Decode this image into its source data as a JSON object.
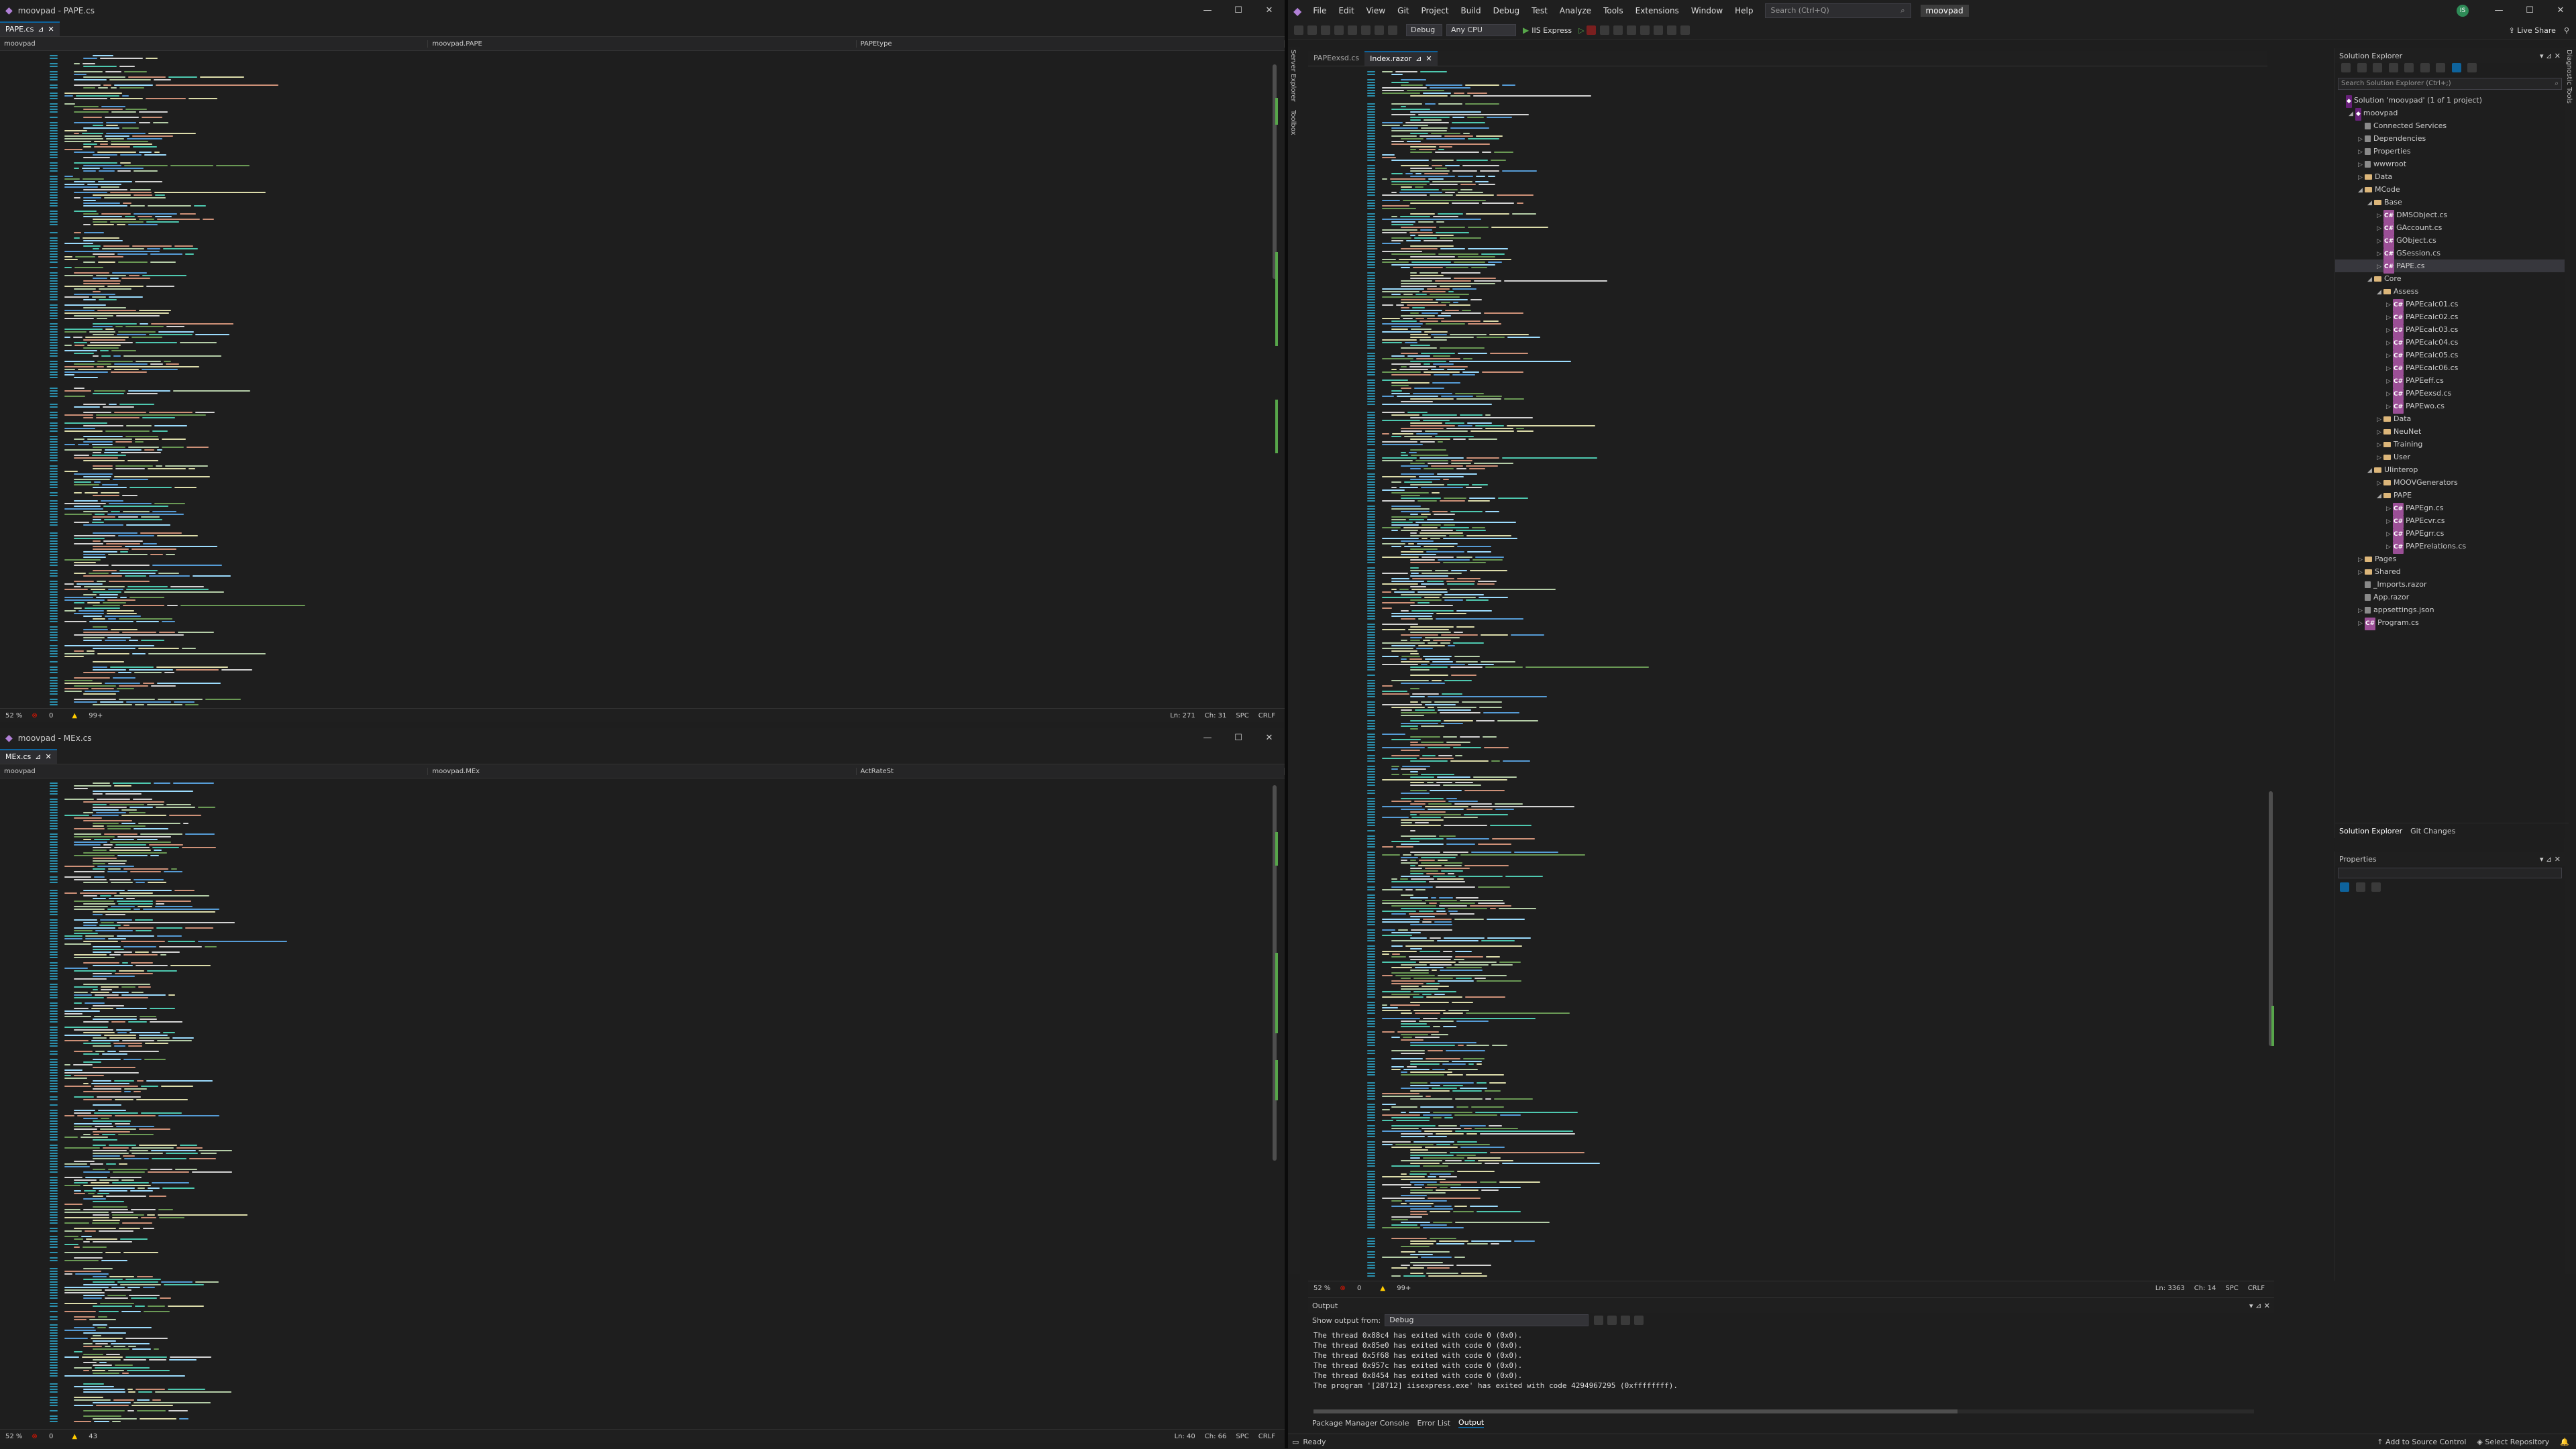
{
  "left_top": {
    "window_title": "moovpad - PAPE.cs",
    "tab": "PAPE.cs",
    "nav": {
      "project": "moovpad",
      "class": "moovpad.PAPE",
      "member": "PAPEtype"
    },
    "status": {
      "zoom": "52 %",
      "errors": "0",
      "warnings": "99+",
      "line": "Ln: 271",
      "col": "Ch: 31",
      "spc": "SPC",
      "crlf": "CRLF"
    }
  },
  "left_bottom": {
    "window_title": "moovpad - MEx.cs",
    "tab": "MEx.cs",
    "nav": {
      "project": "moovpad",
      "class": "moovpad.MEx",
      "member": "ActRateSt"
    },
    "status": {
      "zoom": "52 %",
      "errors": "0",
      "warnings": "43",
      "line": "Ln: 40",
      "col": "Ch: 66",
      "spc": "SPC",
      "crlf": "CRLF"
    }
  },
  "right": {
    "menu": [
      "File",
      "Edit",
      "View",
      "Git",
      "Project",
      "Build",
      "Debug",
      "Test",
      "Analyze",
      "Tools",
      "Extensions",
      "Window",
      "Help"
    ],
    "search_placeholder": "Search (Ctrl+Q)",
    "solution_name": "moovpad",
    "avatar": "IS",
    "toolbar": {
      "config": "Debug",
      "platform": "Any CPU",
      "run_target": "IIS Express",
      "live_share": "Live Share"
    },
    "side_tabs": [
      "Server Explorer",
      "Toolbox"
    ],
    "right_side_tab": "Diagnostic Tools",
    "editor_tabs": [
      {
        "label": "PAPEexsd.cs",
        "active": false
      },
      {
        "label": "Index.razor",
        "active": true
      }
    ],
    "editor_status": {
      "zoom": "52 %",
      "errors": "0",
      "warnings": "99+",
      "line": "Ln: 3363",
      "col": "Ch: 14",
      "spc": "SPC",
      "crlf": "CRLF"
    },
    "output": {
      "title": "Output",
      "show_from_label": "Show output from:",
      "show_from_value": "Debug",
      "lines": [
        "The thread 0x88c4 has exited with code 0 (0x0).",
        "The thread 0x85e0 has exited with code 0 (0x0).",
        "The thread 0x5f68 has exited with code 0 (0x0).",
        "The thread 0x957c has exited with code 0 (0x0).",
        "The thread 0x8454 has exited with code 0 (0x0).",
        "The program '[28712] iisexpress.exe' has exited with code 4294967295 (0xffffffff)."
      ],
      "tabs": [
        "Package Manager Console",
        "Error List",
        "Output"
      ]
    },
    "solution_explorer": {
      "title": "Solution Explorer",
      "search_placeholder": "Search Solution Explorer (Ctrl+;)",
      "items": [
        {
          "label": "Solution 'moovpad' (1 of 1 project)",
          "indent": 0,
          "kind": "solution",
          "arrow": ""
        },
        {
          "label": "moovpad",
          "indent": 1,
          "kind": "project",
          "arrow": "◢"
        },
        {
          "label": "Connected Services",
          "indent": 2,
          "kind": "gen",
          "arrow": ""
        },
        {
          "label": "Dependencies",
          "indent": 2,
          "kind": "gen",
          "arrow": "▷"
        },
        {
          "label": "Properties",
          "indent": 2,
          "kind": "gen",
          "arrow": "▷"
        },
        {
          "label": "wwwroot",
          "indent": 2,
          "kind": "gen",
          "arrow": "▷"
        },
        {
          "label": "Data",
          "indent": 2,
          "kind": "folder",
          "arrow": "▷"
        },
        {
          "label": "MCode",
          "indent": 2,
          "kind": "folder",
          "arrow": "◢"
        },
        {
          "label": "Base",
          "indent": 3,
          "kind": "folder",
          "arrow": "◢"
        },
        {
          "label": "DMSObject.cs",
          "indent": 4,
          "kind": "cs",
          "arrow": "▷"
        },
        {
          "label": "GAccount.cs",
          "indent": 4,
          "kind": "cs",
          "arrow": "▷"
        },
        {
          "label": "GObject.cs",
          "indent": 4,
          "kind": "cs",
          "arrow": "▷"
        },
        {
          "label": "GSession.cs",
          "indent": 4,
          "kind": "cs",
          "arrow": "▷"
        },
        {
          "label": "PAPE.cs",
          "indent": 4,
          "kind": "cs",
          "arrow": "▷",
          "selected": true
        },
        {
          "label": "Core",
          "indent": 3,
          "kind": "folder",
          "arrow": "◢"
        },
        {
          "label": "Assess",
          "indent": 4,
          "kind": "folder",
          "arrow": "◢"
        },
        {
          "label": "PAPEcalc01.cs",
          "indent": 5,
          "kind": "cs",
          "arrow": "▷"
        },
        {
          "label": "PAPEcalc02.cs",
          "indent": 5,
          "kind": "cs",
          "arrow": "▷"
        },
        {
          "label": "PAPEcalc03.cs",
          "indent": 5,
          "kind": "cs",
          "arrow": "▷"
        },
        {
          "label": "PAPEcalc04.cs",
          "indent": 5,
          "kind": "cs",
          "arrow": "▷"
        },
        {
          "label": "PAPEcalc05.cs",
          "indent": 5,
          "kind": "cs",
          "arrow": "▷"
        },
        {
          "label": "PAPEcalc06.cs",
          "indent": 5,
          "kind": "cs",
          "arrow": "▷"
        },
        {
          "label": "PAPEeff.cs",
          "indent": 5,
          "kind": "cs",
          "arrow": "▷"
        },
        {
          "label": "PAPEexsd.cs",
          "indent": 5,
          "kind": "cs",
          "arrow": "▷"
        },
        {
          "label": "PAPEwo.cs",
          "indent": 5,
          "kind": "cs",
          "arrow": "▷"
        },
        {
          "label": "Data",
          "indent": 4,
          "kind": "folder",
          "arrow": "▷"
        },
        {
          "label": "NeuNet",
          "indent": 4,
          "kind": "folder",
          "arrow": "▷"
        },
        {
          "label": "Training",
          "indent": 4,
          "kind": "folder",
          "arrow": "▷"
        },
        {
          "label": "User",
          "indent": 4,
          "kind": "folder",
          "arrow": "▷"
        },
        {
          "label": "UIinterop",
          "indent": 3,
          "kind": "folder",
          "arrow": "◢"
        },
        {
          "label": "MOOVGenerators",
          "indent": 4,
          "kind": "folder",
          "arrow": "▷"
        },
        {
          "label": "PAPE",
          "indent": 4,
          "kind": "folder",
          "arrow": "◢"
        },
        {
          "label": "PAPEgn.cs",
          "indent": 5,
          "kind": "cs",
          "arrow": "▷"
        },
        {
          "label": "PAPEcvr.cs",
          "indent": 5,
          "kind": "cs",
          "arrow": "▷"
        },
        {
          "label": "PAPEgrr.cs",
          "indent": 5,
          "kind": "cs",
          "arrow": "▷"
        },
        {
          "label": "PAPErelations.cs",
          "indent": 5,
          "kind": "cs",
          "arrow": "▷"
        },
        {
          "label": "Pages",
          "indent": 2,
          "kind": "folder",
          "arrow": "▷"
        },
        {
          "label": "Shared",
          "indent": 2,
          "kind": "folder",
          "arrow": "▷"
        },
        {
          "label": "_Imports.razor",
          "indent": 2,
          "kind": "gen",
          "arrow": ""
        },
        {
          "label": "App.razor",
          "indent": 2,
          "kind": "gen",
          "arrow": ""
        },
        {
          "label": "appsettings.json",
          "indent": 2,
          "kind": "gen",
          "arrow": "▷"
        },
        {
          "label": "Program.cs",
          "indent": 2,
          "kind": "cs",
          "arrow": "▷"
        }
      ],
      "bottom_tabs": [
        "Solution Explorer",
        "Git Changes"
      ]
    },
    "properties_title": "Properties",
    "statusbar": {
      "ready": "Ready",
      "source_control": "Add to Source Control",
      "repo": "Select Repository"
    }
  },
  "colors": {
    "accent": "#0e639c",
    "vs_purple": "#68217a",
    "status_ok": "#57a64a",
    "error_red": "#e51400",
    "warning_yellow": "#ffcc00"
  }
}
